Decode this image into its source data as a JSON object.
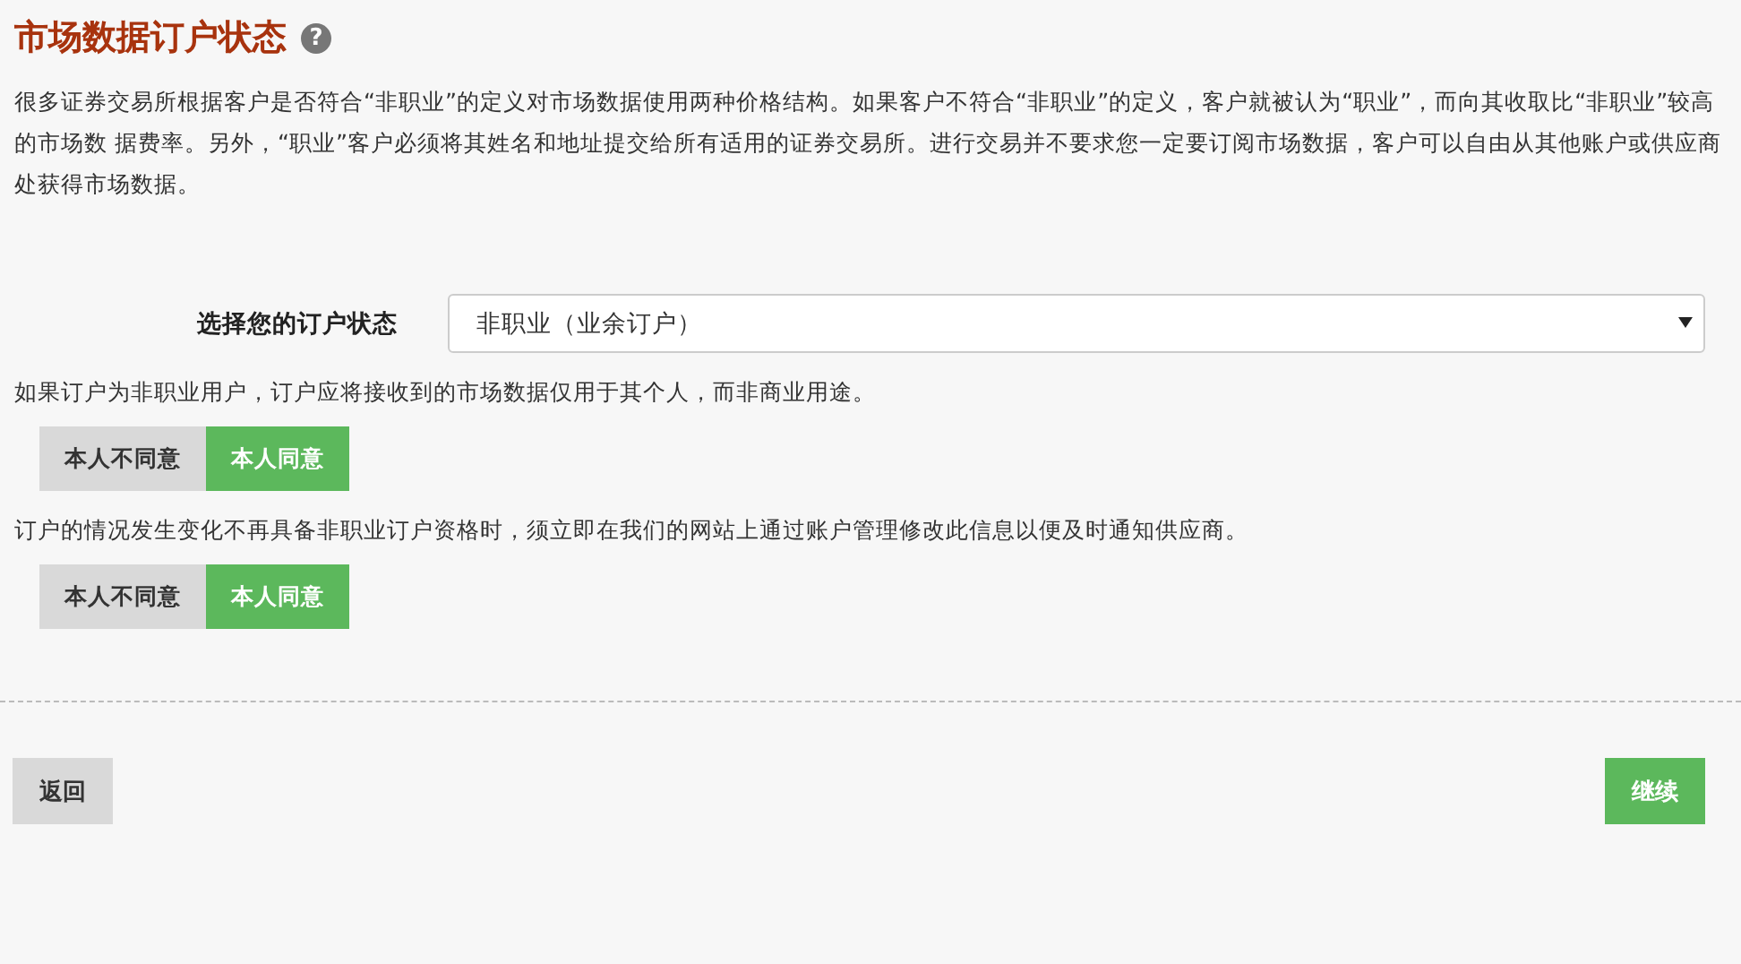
{
  "header": {
    "title": "市场数据订户状态",
    "help_icon": "?"
  },
  "intro": "很多证券交易所根据客户是否符合“非职业”的定义对市场数据使用两种价格结构。如果客户不符合“非职业”的定义，客户就被认为“职业”，而向其收取比“非职业”较高的市场数 据费率。另外，“职业”客户必须将其姓名和地址提交给所有适用的证券交易所。进行交易并不要求您一定要订阅市场数据，客户可以自由从其他账户或供应商处获得市场数据。",
  "status": {
    "label": "选择您的订户状态",
    "value": "非职业（业余订户）"
  },
  "agreements": [
    {
      "text": "如果订户为非职业用户，订户应将接收到的市场数据仅用于其个人，而非商业用途。",
      "options": [
        {
          "label": "本人不同意",
          "selected": false
        },
        {
          "label": "本人同意",
          "selected": true
        }
      ]
    },
    {
      "text": "订户的情况发生变化不再具备非职业订户资格时，须立即在我们的网站上通过账户管理修改此信息以便及时通知供应商。",
      "options": [
        {
          "label": "本人不同意",
          "selected": false
        },
        {
          "label": "本人同意",
          "selected": true
        }
      ]
    }
  ],
  "footer": {
    "back": "返回",
    "continue": "继续"
  }
}
